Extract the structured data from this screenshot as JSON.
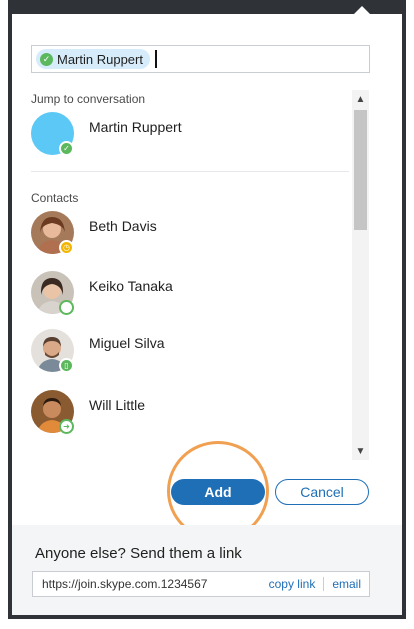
{
  "to_field": {
    "chip_name": "Martin Ruppert",
    "chip_status_color": "#5cb85c"
  },
  "jump_section": {
    "label": "Jump to conversation",
    "item": {
      "name": "Martin Ruppert",
      "avatar_color": "#5bc8f5",
      "status": "available",
      "status_color": "#5cb85c"
    }
  },
  "contacts_section": {
    "label": "Contacts",
    "items": [
      {
        "name": "Beth Davis",
        "status": "away",
        "status_color": "#f2b600",
        "status_icon": "clock-icon"
      },
      {
        "name": "Keiko Tanaka",
        "status": "offline",
        "status_color": "#ffffff",
        "status_icon": "offline-ring-icon"
      },
      {
        "name": "Miguel Silva",
        "status": "mobile",
        "status_color": "#5cb85c",
        "status_icon": "mobile-icon"
      },
      {
        "name": "Will Little",
        "status": "forwarding",
        "status_color": "#5cb85c",
        "status_icon": "forward-arrow-icon"
      }
    ]
  },
  "buttons": {
    "add_label": "Add",
    "cancel_label": "Cancel"
  },
  "share_link": {
    "title": "Anyone else? Send them a link",
    "url": "https://join.skype.com.1234567",
    "copy_label": "copy link",
    "email_label": "email"
  },
  "colors": {
    "accent": "#1e6fb6",
    "highlight_ring": "#f0a050",
    "frame": "#2f3236"
  }
}
